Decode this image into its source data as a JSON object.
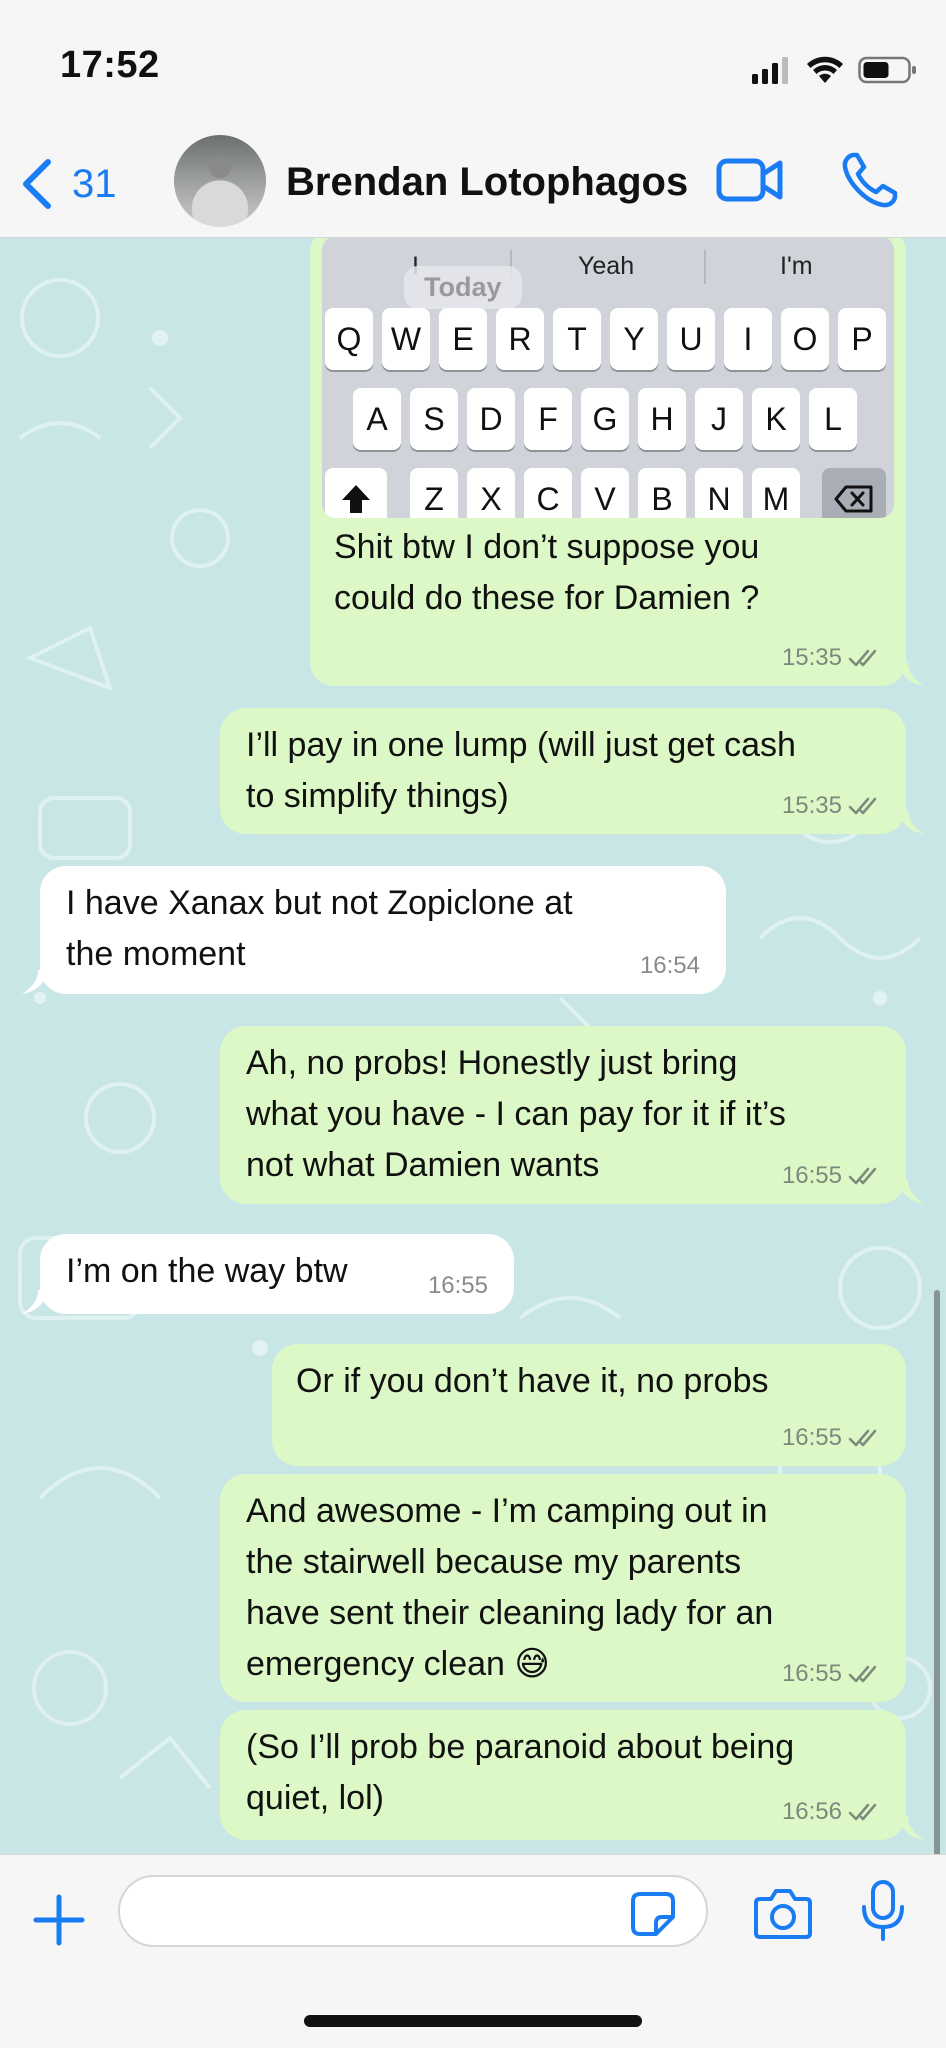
{
  "status_bar": {
    "time": "17:52"
  },
  "header": {
    "back_count": "31",
    "contact_name": "Brendan Lotophagos"
  },
  "keyboard_image": {
    "suggestions": [
      "I",
      "Yeah",
      "I'm"
    ],
    "date_chip": "Today",
    "row1": [
      "Q",
      "W",
      "E",
      "R",
      "T",
      "Y",
      "U",
      "I",
      "O",
      "P"
    ],
    "row2": [
      "A",
      "S",
      "D",
      "F",
      "G",
      "H",
      "J",
      "K",
      "L"
    ],
    "row3": [
      "Z",
      "X",
      "C",
      "V",
      "B",
      "N",
      "M"
    ]
  },
  "messages": [
    {
      "dir": "out",
      "text_lines": [
        "Shit btw I don’t suppose you",
        "could do these for Damien ?"
      ],
      "time": "15:35"
    },
    {
      "dir": "out",
      "text_lines": [
        "I’ll pay in one lump (will just get cash",
        "to simplify things)"
      ],
      "time": "15:35"
    },
    {
      "dir": "in",
      "text_lines": [
        "I have Xanax but not Zopiclone at",
        "the moment"
      ],
      "time": "16:54"
    },
    {
      "dir": "out",
      "text_lines": [
        "Ah, no probs! Honestly just bring",
        "what you have - I can pay for it if it’s",
        "not what Damien wants"
      ],
      "time": "16:55"
    },
    {
      "dir": "in",
      "text_lines": [
        "I’m on the way btw"
      ],
      "time": "16:55"
    },
    {
      "dir": "out",
      "text_lines": [
        "Or if you don’t have it, no probs"
      ],
      "time": "16:55"
    },
    {
      "dir": "out",
      "text_lines": [
        "And awesome - I’m camping out in",
        "the stairwell because my parents",
        "have sent their cleaning lady for an",
        "emergency clean 😅"
      ],
      "time": "16:55"
    },
    {
      "dir": "out",
      "text_lines": [
        "(So I’ll prob be paranoid about being",
        "quiet, lol)"
      ],
      "time": "16:56"
    }
  ],
  "input": {
    "placeholder": ""
  },
  "colors": {
    "accent": "#1a7cf2",
    "outgoing_bubble": "#dcf8c6",
    "incoming_bubble": "#ffffff",
    "chat_background": "#c9e6e6"
  },
  "icons": [
    "back-chevron-icon",
    "avatar",
    "video-call-icon",
    "phone-icon",
    "plus-icon",
    "sticker-icon",
    "camera-icon",
    "microphone-icon",
    "read-receipt-icon"
  ]
}
